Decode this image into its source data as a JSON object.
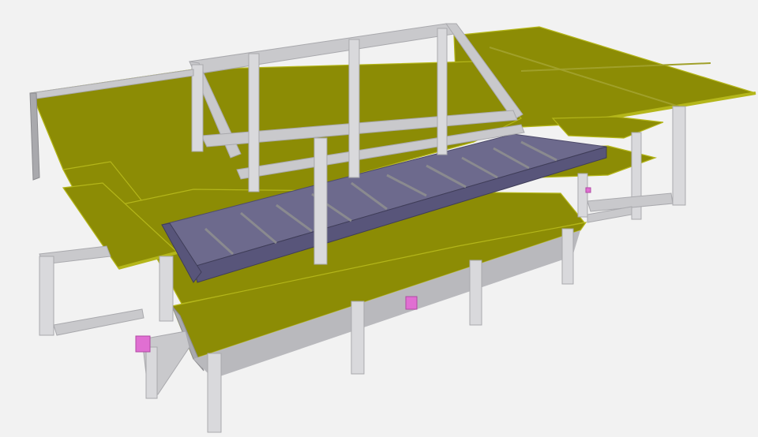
{
  "viewport": {
    "background": "#f2f2f2",
    "model_colors": {
      "slab": "#8c8c05",
      "slab_edge": "#b4b61a",
      "column": "#d9d9dc",
      "column_shade": "#a9a9ad",
      "beam": "#c9c9cc",
      "steel_beam": "#6d6a8d",
      "joist": "#8a8a8f",
      "connector": "#e06fd2"
    }
  }
}
